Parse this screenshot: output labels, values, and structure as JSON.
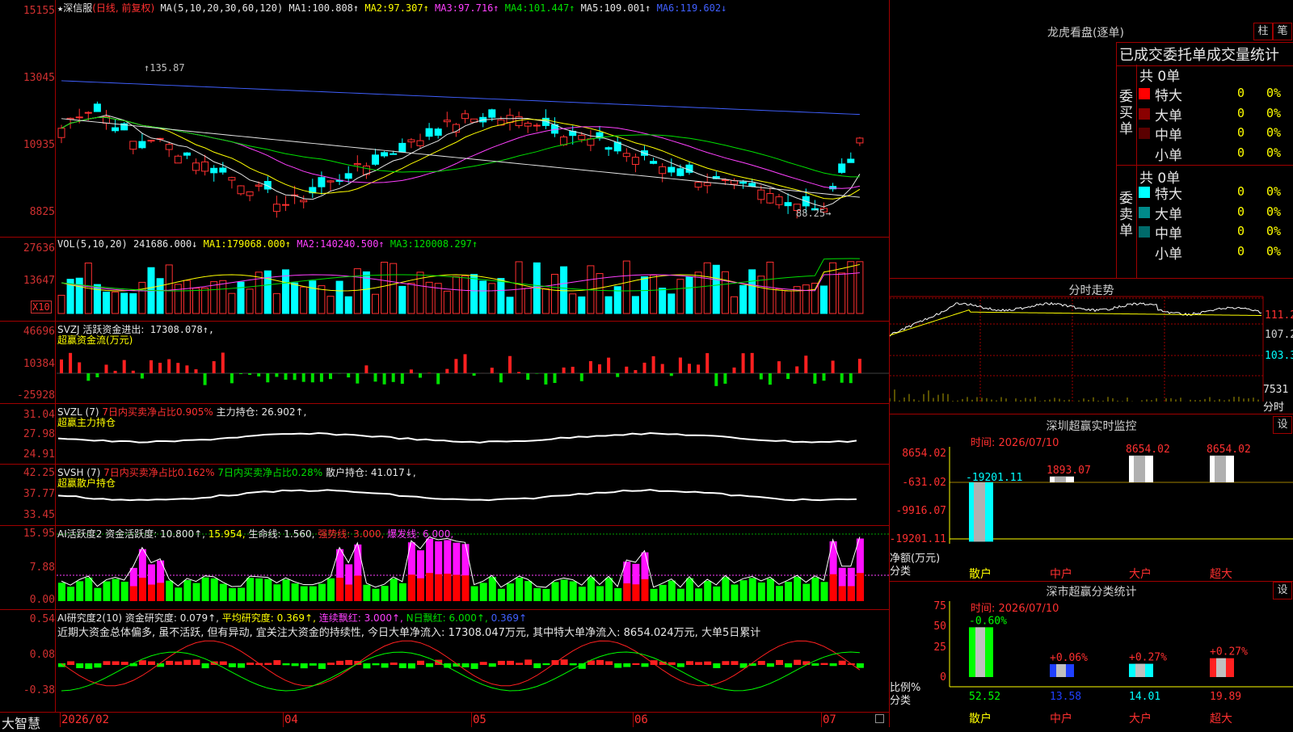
{
  "main": {
    "title": "★深信服",
    "mode": "(日线, 前复权)",
    "ma_label": "MA(5,10,20,30,60,120)",
    "ma": [
      {
        "label": "MA1:",
        "value": "100.808↑",
        "color": "#e6e6e6"
      },
      {
        "label": "MA2:",
        "value": "97.307↑",
        "color": "#ffff00"
      },
      {
        "label": "MA3:",
        "value": "97.716↑",
        "color": "#ff40ff"
      },
      {
        "label": "MA4:",
        "value": "101.447↑",
        "color": "#00e000"
      },
      {
        "label": "MA5:",
        "value": "109.001↑",
        "color": "#e6e6e6"
      },
      {
        "label": "MA6:",
        "value": "119.602↓",
        "color": "#4060ff"
      }
    ],
    "yticks": [
      "15155",
      "13045",
      "10935",
      "8825"
    ],
    "high_label": "135.87",
    "low_label": "88.25",
    "bottom_label": "大智慧",
    "dates": [
      "2026/02",
      "04",
      "05",
      "06",
      "07"
    ]
  },
  "vol": {
    "header": "VOL(5,10,20)",
    "value": "241686.000↓",
    "ma": [
      {
        "label": "MA1:",
        "value": "179068.000↑",
        "color": "#ffff00"
      },
      {
        "label": "MA2:",
        "value": "140240.500↑",
        "color": "#ff40ff"
      },
      {
        "label": "MA3:",
        "value": "120008.297↑",
        "color": "#00e000"
      }
    ],
    "yticks": [
      "27636",
      "13647"
    ],
    "unit": "X10"
  },
  "svzj": {
    "header": "SVZJ  活跃资金进出:",
    "value": "17308.078↑,",
    "sub": "超赢资金流(万元)",
    "yticks": [
      "46696",
      "10384",
      "-25928"
    ]
  },
  "svzl": {
    "header": "SVZL (7)",
    "p1": "7日内买卖净占比0.905%",
    "p2": "主力持仓:",
    "v2": "26.902↑,",
    "sub": "超赢主力持仓",
    "yticks": [
      "31.04",
      "27.98",
      "24.91"
    ]
  },
  "svsh": {
    "header": "SVSH (7)",
    "p1": "7日内买卖净占比0.162%",
    "p2": "7日内买卖净占比0.28%",
    "p3": "散户持仓:",
    "v3": "41.017↓,",
    "sub": "超赢散户持仓",
    "yticks": [
      "42.25",
      "37.77",
      "33.45"
    ]
  },
  "ai1": {
    "header": "AI活跃度2",
    "p1": "资金活跃度:",
    "v1": "10.800↑,",
    "v2": "15.954,",
    "p3": "生命线:",
    "v3": "1.560,",
    "p4": "强势线:",
    "v4": "3.000,",
    "p5": "爆发线:",
    "v5": "6.000,",
    "yticks": [
      "15.95",
      "7.88",
      "0.00"
    ]
  },
  "ai2": {
    "header": "AI研究度2(10)",
    "p1": "资金研究度:",
    "v1": "0.079↑,",
    "p2": "平均研究度:",
    "v2": "0.369↑,",
    "p3": "连续飘红:",
    "v3": "3.000↑,",
    "p4": "N日飘红:",
    "v4": "6.000↑,",
    "v5": "0.369↑",
    "text": "近期大资金总体偏多, 虽不活跃, 但有异动, 宜关注大资金的持续性, 今日大单净流入: 17308.047万元, 其中特大单净流入: 8654.024万元, 大单5日累计",
    "yticks": [
      "0.54",
      "0.08",
      "-0.38"
    ]
  },
  "lhb": {
    "title": "龙虎看盘(逐单)",
    "btn1": "柱",
    "btn2": "笔",
    "subtitle": "已成交委托单成交量统计",
    "buy_label": "委买单",
    "sell_label": "委卖单",
    "buy_total": "共 0单",
    "sell_total": "共 0单",
    "buy_rows": [
      {
        "name": "特大",
        "count": "0",
        "pct": "0%",
        "color": "#ff0000"
      },
      {
        "name": "大单",
        "count": "0",
        "pct": "0%",
        "color": "#8a0000"
      },
      {
        "name": "中单",
        "count": "0",
        "pct": "0%",
        "color": "#5a0000"
      },
      {
        "name": "小单",
        "count": "0",
        "pct": "0%",
        "color": ""
      }
    ],
    "sell_rows": [
      {
        "name": "特大",
        "count": "0",
        "pct": "0%",
        "color": "#00ffff"
      },
      {
        "name": "大单",
        "count": "0",
        "pct": "0%",
        "color": "#008a8a"
      },
      {
        "name": "中单",
        "count": "0",
        "pct": "0%",
        "color": "#006a6a"
      },
      {
        "name": "小单",
        "count": "0",
        "pct": "0%",
        "color": ""
      }
    ]
  },
  "fenshi": {
    "title": "分时走势",
    "yticks": [
      "111.2",
      "107.2",
      "103.3"
    ],
    "vol_label": "7531",
    "bottom": "分时"
  },
  "sz_monitor": {
    "title": "深圳超赢实时监控",
    "btn": "设",
    "time": "时间: 2026/07/10",
    "yticks": [
      "8654.02",
      "-631.02",
      "-9916.07",
      "-19201.11"
    ],
    "axis_label": "净额(万元)",
    "cat_label": "分类",
    "bars": [
      {
        "name": "散户",
        "value": "-19201.11",
        "num": -19201.11,
        "color": "#00ffff",
        "label_color": "#00ffff",
        "name_color": "#ffff00"
      },
      {
        "name": "中户",
        "value": "1893.07",
        "num": 1893.07,
        "color": "#ffffff",
        "label_color": "#ff3030",
        "name_color": "#ff3030"
      },
      {
        "name": "大户",
        "value": "8654.02",
        "num": 8654.02,
        "color": "#ffffff",
        "label_color": "#ff3030",
        "name_color": "#ff3030"
      },
      {
        "name": "超大",
        "value": "8654.02",
        "num": 8654.02,
        "color": "#ffffff",
        "label_color": "#ff3030",
        "name_color": "#ff3030"
      }
    ]
  },
  "sh_class": {
    "title": "深市超赢分类统计",
    "btn": "设",
    "time": "时间: 2026/07/10",
    "yticks": [
      "75",
      "50",
      "25",
      "0"
    ],
    "axis_label": "比例%",
    "cat_label": "分类",
    "bars": [
      {
        "name": "散户",
        "pct": 52.52,
        "label": "52.52",
        "delta": "-0.60%",
        "color": "#00ff00",
        "label_color": "#00ff00",
        "delta_color": "#00ff00"
      },
      {
        "name": "中户",
        "pct": 13.58,
        "label": "13.58",
        "delta": "+0.06%",
        "color": "#2040ff",
        "label_color": "#2040ff",
        "delta_color": "#ff3030"
      },
      {
        "name": "大户",
        "pct": 14.01,
        "label": "14.01",
        "delta": "+0.27%",
        "color": "#00ffff",
        "label_color": "#00ffff",
        "delta_color": "#ff3030"
      },
      {
        "name": "超大",
        "pct": 19.89,
        "label": "19.89",
        "delta": "+0.27%",
        "color": "#ff2020",
        "label_color": "#ff3030",
        "delta_color": "#ff3030"
      }
    ]
  }
}
